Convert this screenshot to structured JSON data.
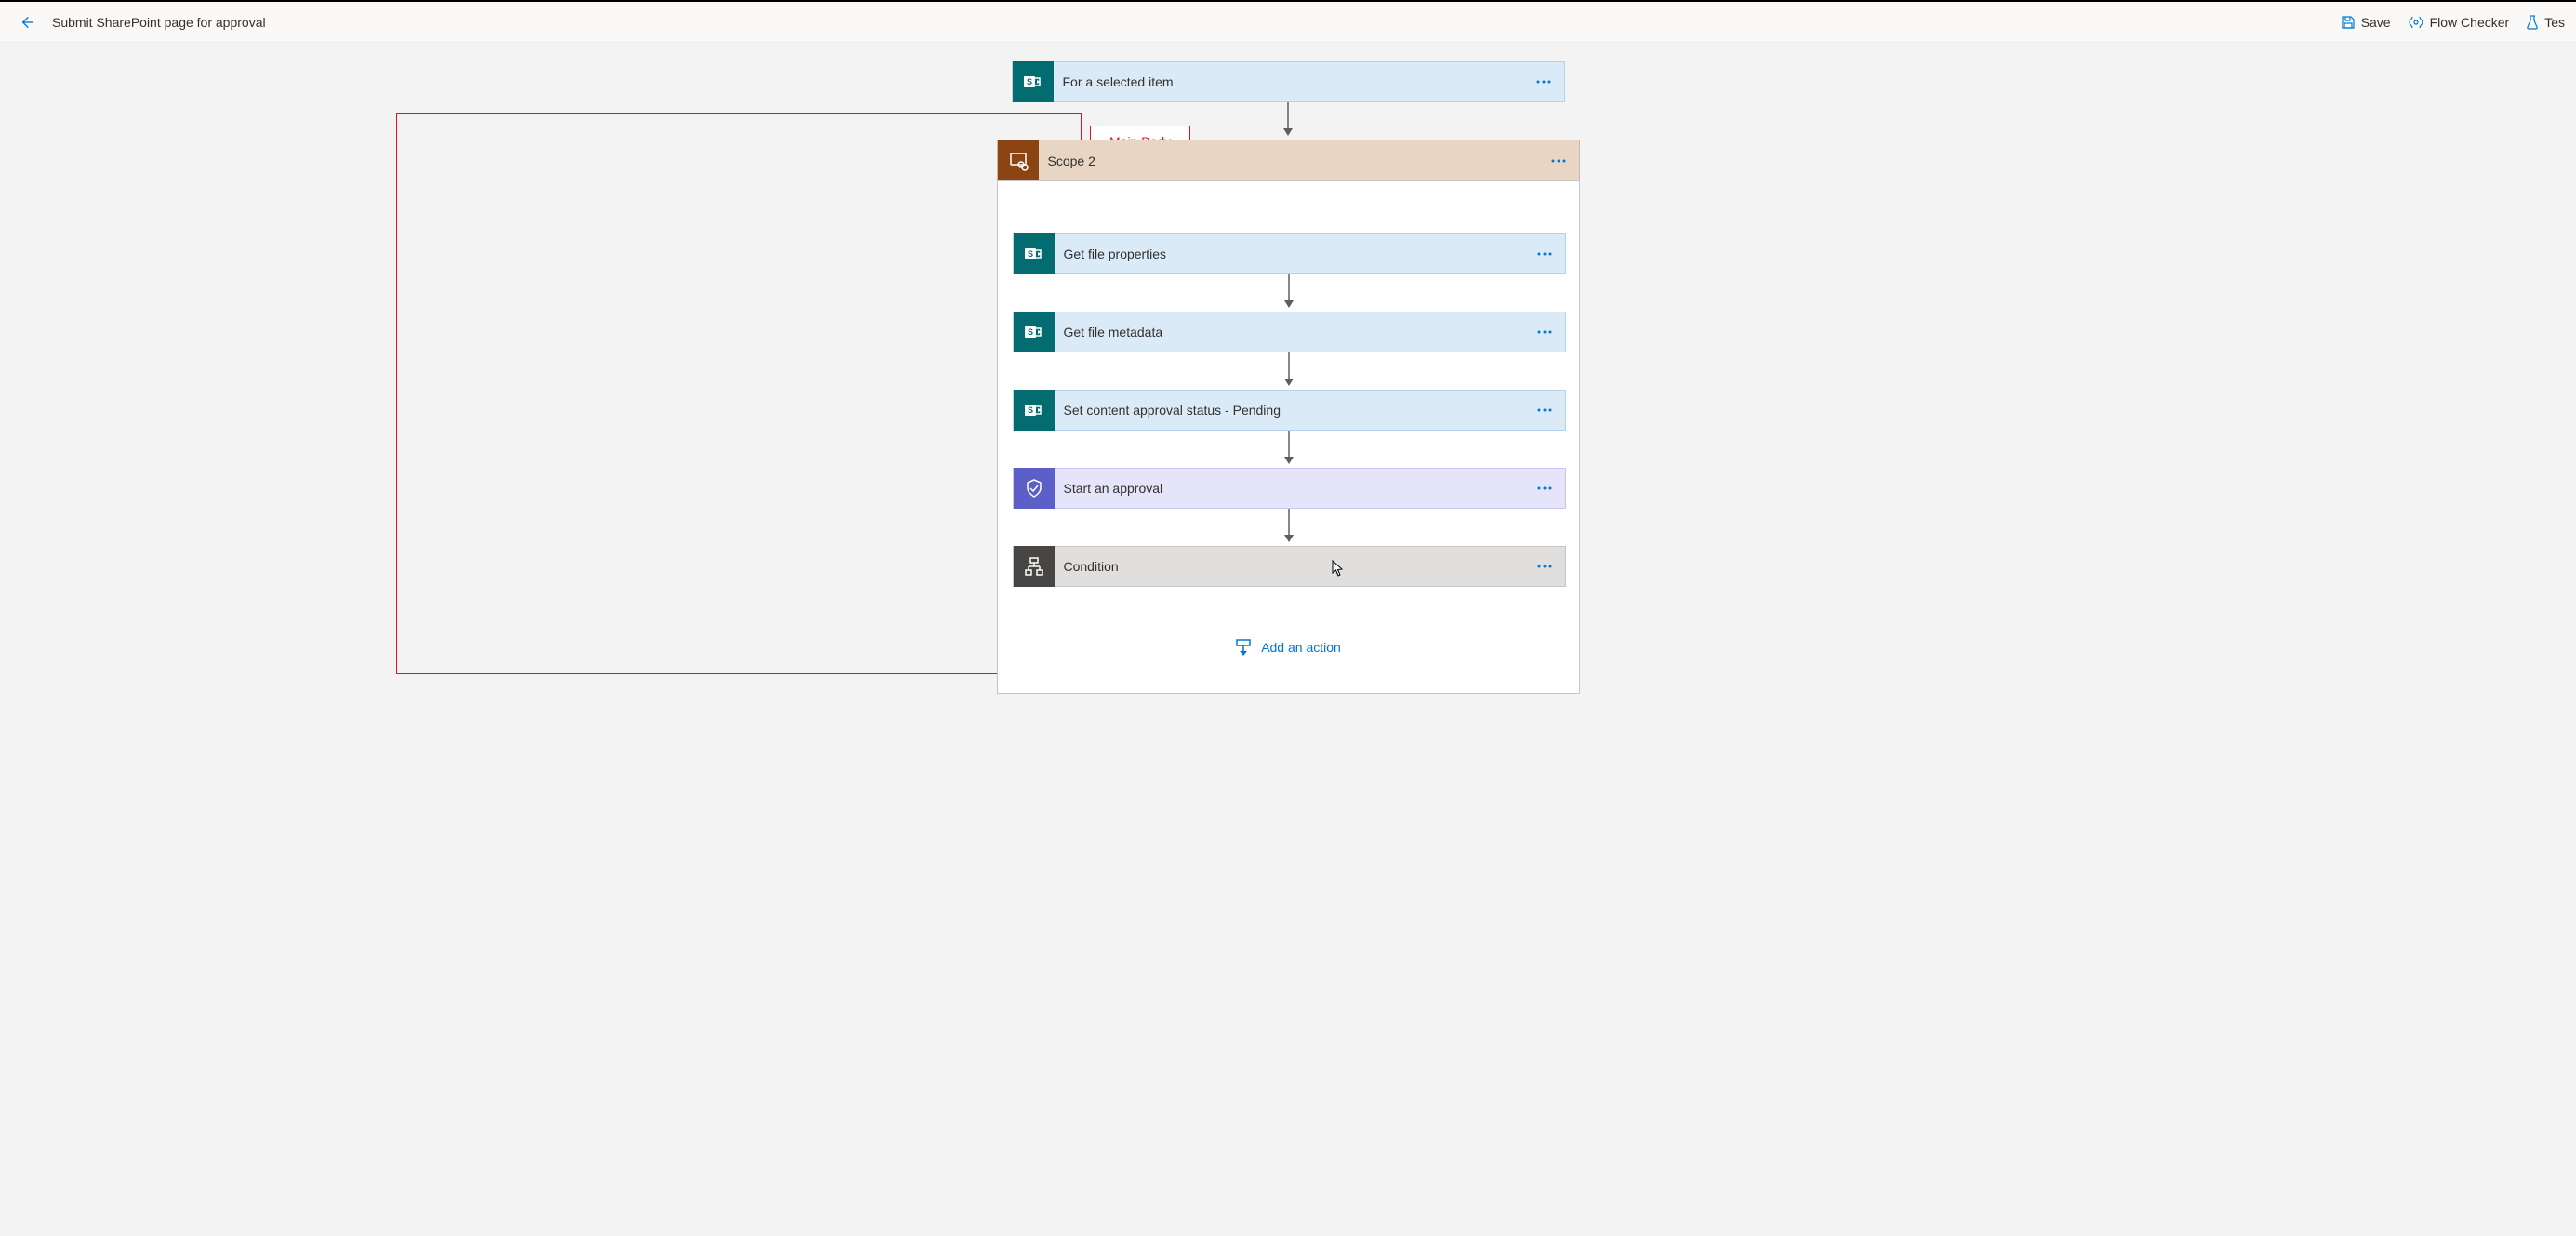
{
  "header": {
    "title": "Submit SharePoint page for approval",
    "save": "Save",
    "flowChecker": "Flow Checker",
    "test": "Tes"
  },
  "trigger": {
    "title": "For a selected item"
  },
  "scope": {
    "title": "Scope 2",
    "actions": [
      {
        "title": "Get file properties",
        "type": "sharepoint"
      },
      {
        "title": "Get file metadata",
        "type": "sharepoint"
      },
      {
        "title": "Set content approval status - Pending",
        "type": "sharepoint"
      },
      {
        "title": "Start an approval",
        "type": "approval"
      },
      {
        "title": "Condition",
        "type": "condition"
      }
    ],
    "addAction": "Add an action"
  },
  "annotation": {
    "label": "Main Body"
  }
}
